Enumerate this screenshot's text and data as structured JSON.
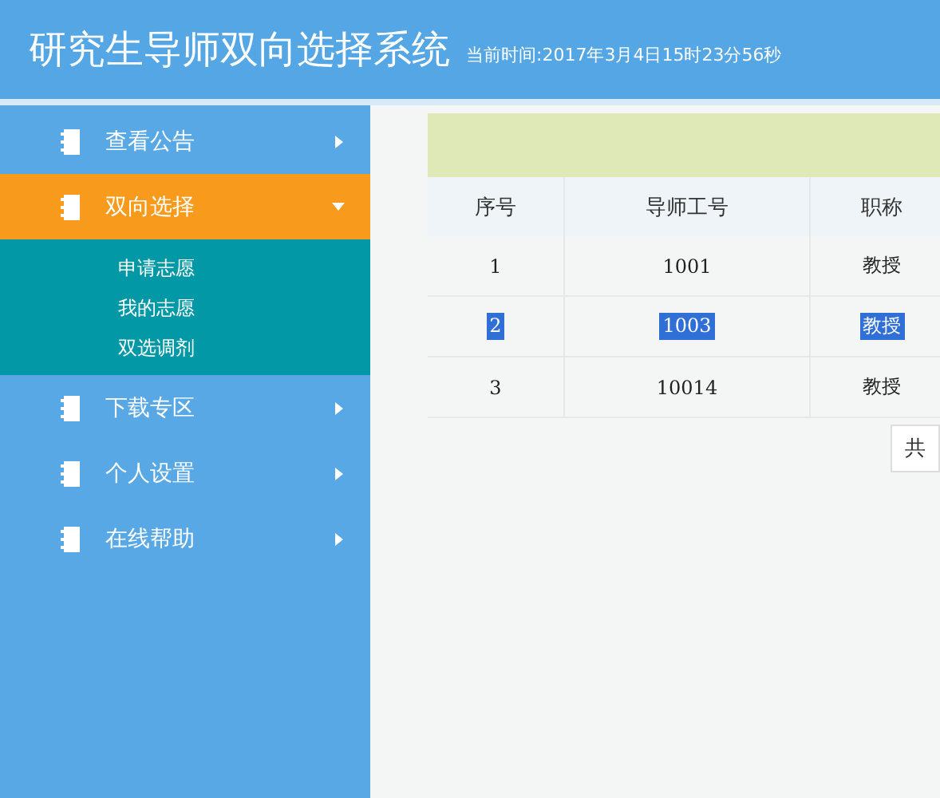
{
  "header": {
    "title": "研究生导师双向选择系统",
    "clock": "当前时间:2017年3月4日15时23分56秒"
  },
  "sidebar": {
    "items": [
      {
        "label": "查看公告",
        "selected": false,
        "expanded": false
      },
      {
        "label": "双向选择",
        "selected": true,
        "expanded": true,
        "children": [
          {
            "label": "申请志愿"
          },
          {
            "label": "我的志愿"
          },
          {
            "label": "双选调剂"
          }
        ]
      },
      {
        "label": "下载专区",
        "selected": false,
        "expanded": false
      },
      {
        "label": "个人设置",
        "selected": false,
        "expanded": false
      },
      {
        "label": "在线帮助",
        "selected": false,
        "expanded": false
      }
    ]
  },
  "table": {
    "columns": [
      "序号",
      "导师工号",
      "职称"
    ],
    "rows": [
      {
        "cells": [
          "1",
          "1001",
          "教授"
        ],
        "selected": false
      },
      {
        "cells": [
          "2",
          "1003",
          "教授"
        ],
        "selected": true
      },
      {
        "cells": [
          "3",
          "10014",
          "教授"
        ],
        "selected": false
      }
    ]
  },
  "pager": {
    "text": "共"
  }
}
